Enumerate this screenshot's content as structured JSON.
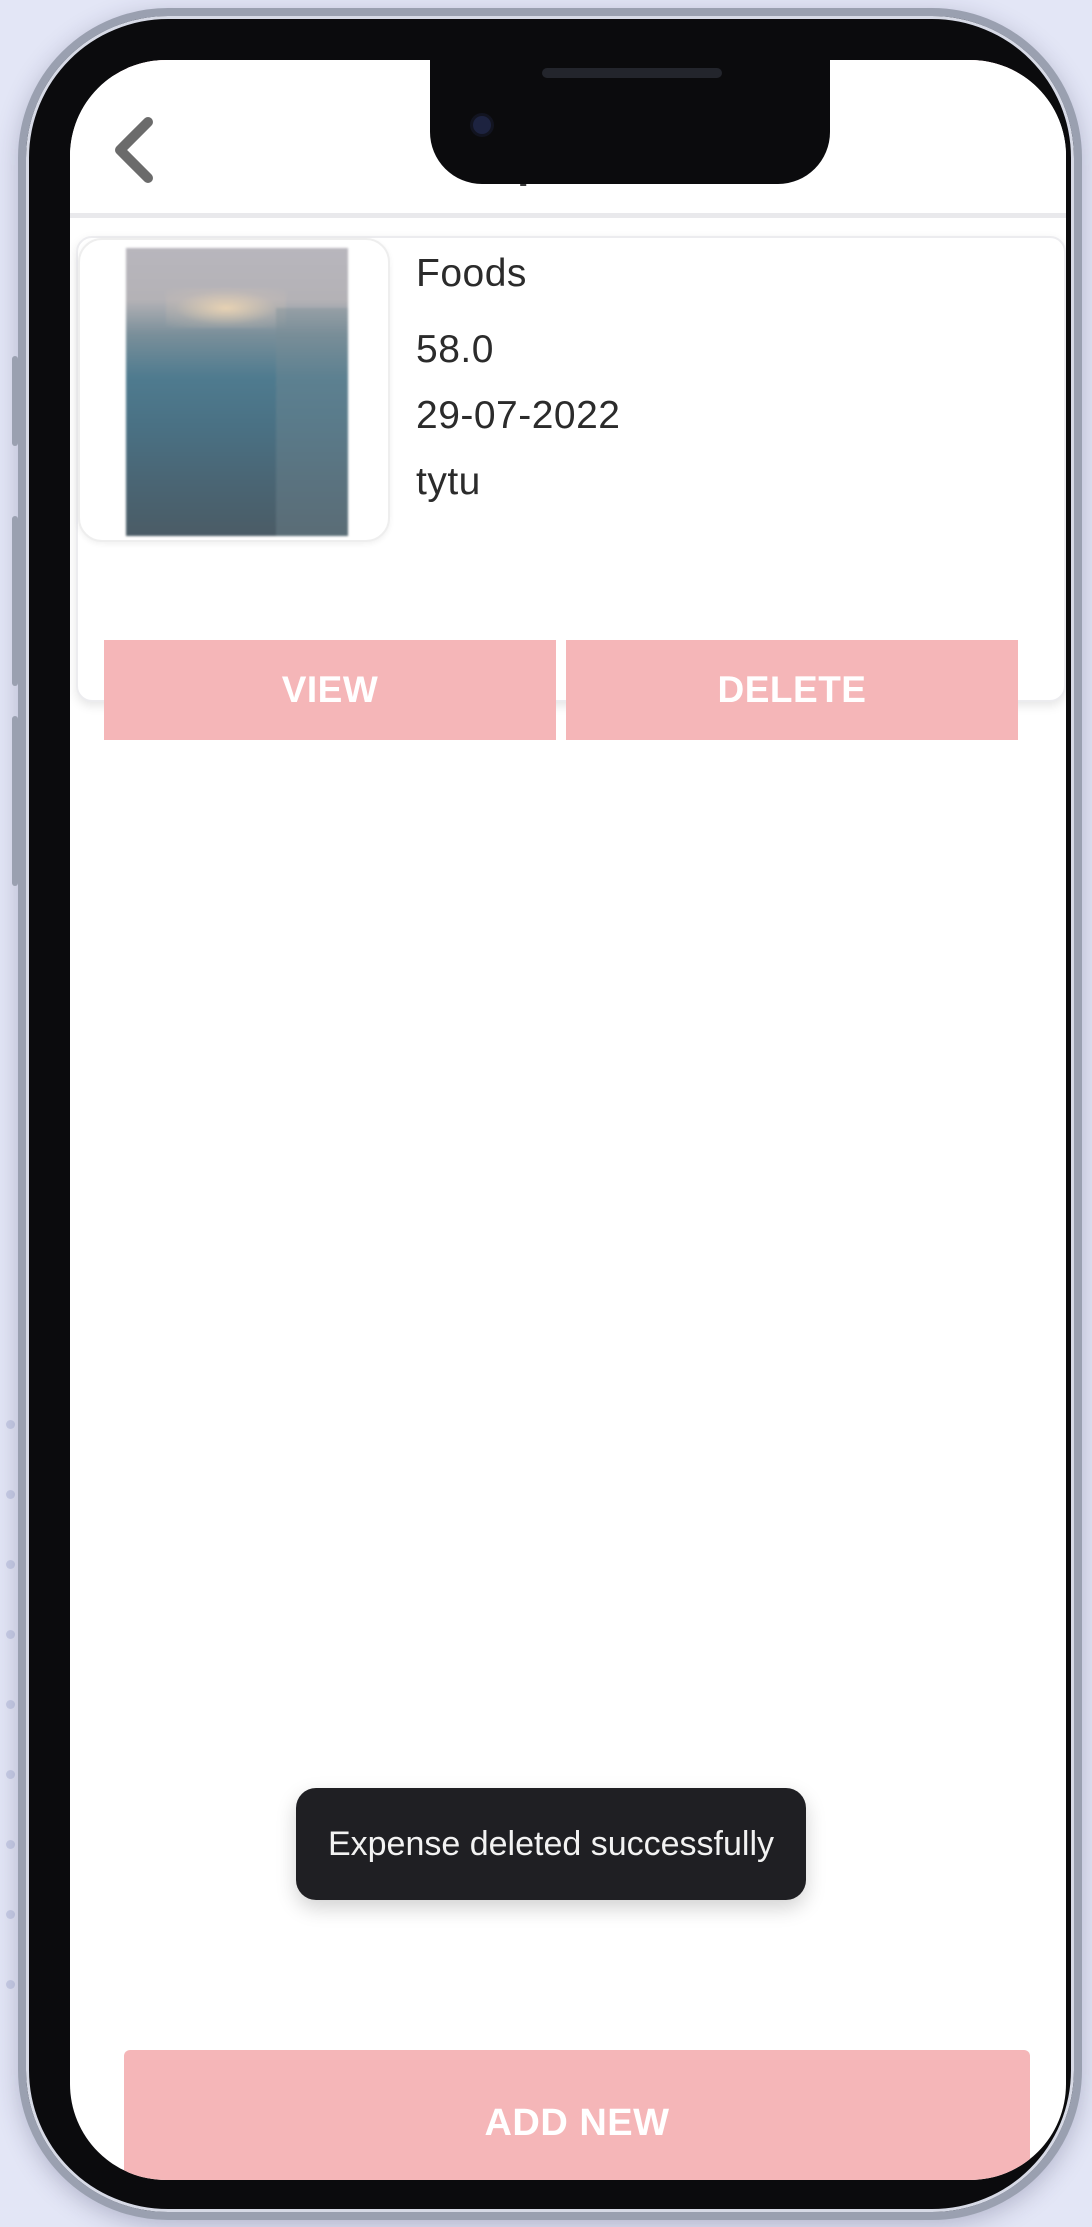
{
  "app": {
    "title": "Expenses",
    "accent_color": "#f5b6b8"
  },
  "header": {
    "back_icon": "chevron-left-icon",
    "title": "Expenses"
  },
  "expenses": [
    {
      "category": "Foods",
      "amount": "58.0",
      "date": "29-07-2022",
      "note": "tytu",
      "thumbnail": "receipt-photo",
      "view_label": "VIEW",
      "delete_label": "DELETE"
    }
  ],
  "toast": {
    "message": "Expense deleted successfully"
  },
  "footer": {
    "add_label": "ADD NEW"
  }
}
